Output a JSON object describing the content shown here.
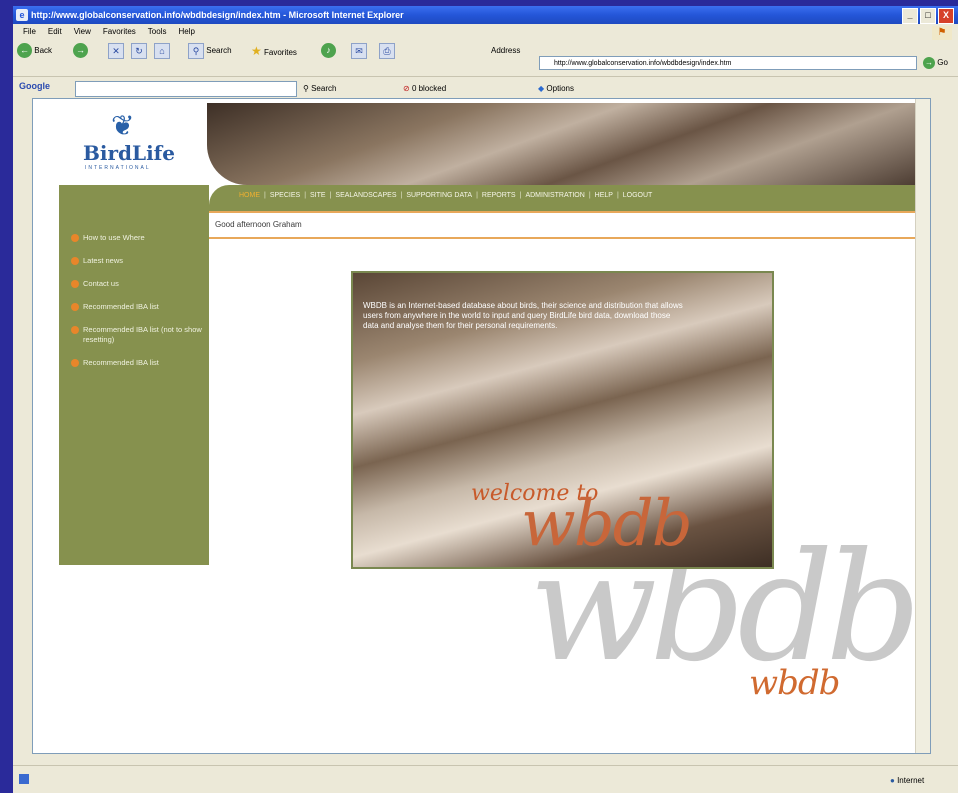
{
  "window": {
    "title": "http://www.globalconservation.info/wbdbdesign/index.htm - Microsoft Internet Explorer",
    "controls": [
      "_",
      "□",
      "X"
    ]
  },
  "menu": [
    "File",
    "Edit",
    "View",
    "Favorites",
    "Tools",
    "Help"
  ],
  "toolbar": {
    "back": "Back",
    "search": "Search",
    "favorites": "Favorites",
    "address_label": "Address",
    "address_value": "http://www.globalconservation.info/wbdbdesign/index.htm",
    "go": "Go"
  },
  "google_bar": {
    "logo": "Google",
    "search": "Search",
    "blocked": "0 blocked",
    "options": "Options"
  },
  "page": {
    "logo_name": "BirdLife",
    "logo_sub": "INTERNATIONAL",
    "nav": [
      "HOME",
      "SPECIES",
      "SITE",
      "SEALANDSCAPES",
      "SUPPORTING DATA",
      "REPORTS",
      "ADMINISTRATION",
      "HELP",
      "LOGOUT"
    ],
    "greeting": "Good afternoon Graham",
    "sidebar": [
      "How to use Where",
      "Latest news",
      "Contact us",
      "Recommended IBA list",
      "Recommended IBA list (not to show resetting)",
      "Recommended IBA list"
    ],
    "welcome_text": "WBDB is an Internet-based database about birds, their science and distribution that allows users from anywhere in the world to input and query BirdLife bird data, download those data and analyse them for their personal requirements.",
    "welcome_to": "welcome to",
    "welcome_logo": "wbdb",
    "watermark": "wbdb",
    "watermark_small": "wbdb"
  },
  "status": {
    "zone": "Internet"
  }
}
